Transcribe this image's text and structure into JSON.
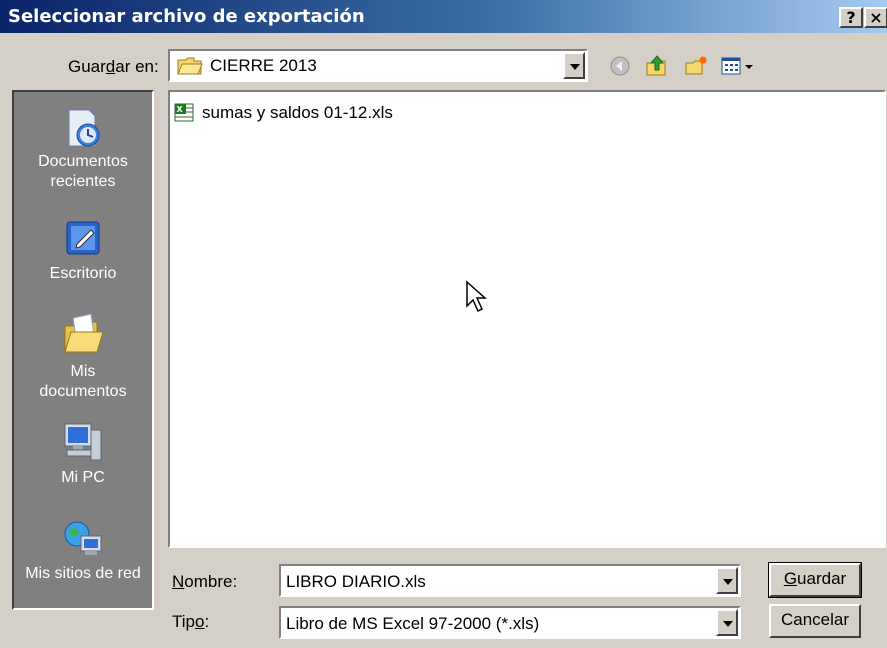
{
  "window": {
    "title": "Seleccionar archivo de exportación",
    "help_label": "?",
    "close_label": "×"
  },
  "toolbar": {
    "save_in_label_before": "Guar",
    "save_in_label_mnemonic": "d",
    "save_in_label_after": "ar en:",
    "location": "CIERRE 2013",
    "icons": [
      "back-icon",
      "up-folder-icon",
      "new-folder-icon",
      "view-menu-icon"
    ]
  },
  "places": [
    {
      "label_line1": "Documentos",
      "label_line2": "recientes",
      "icon": "recent-documents-icon"
    },
    {
      "label_line1": "Escritorio",
      "label_line2": "",
      "icon": "desktop-icon"
    },
    {
      "label_line1": "Mis",
      "label_line2": "documentos",
      "icon": "my-documents-icon"
    },
    {
      "label_line1": "Mi PC",
      "label_line2": "",
      "icon": "my-computer-icon"
    },
    {
      "label_line1": "Mis sitios de red",
      "label_line2": "",
      "icon": "network-places-icon"
    }
  ],
  "files": [
    {
      "name": "sumas y saldos 01-12.xls",
      "icon": "excel-file-icon"
    }
  ],
  "form": {
    "name_label_mnemonic": "N",
    "name_label_rest": "ombre:",
    "file_name": "LIBRO DIARIO.xls",
    "type_label_before": "Tip",
    "type_label_mnemonic": "o",
    "type_label_after": ":",
    "file_type": "Libro de MS Excel 97-2000 (*.xls)"
  },
  "buttons": {
    "save_mnemonic": "G",
    "save_rest": "uardar",
    "cancel": "Cancelar"
  }
}
